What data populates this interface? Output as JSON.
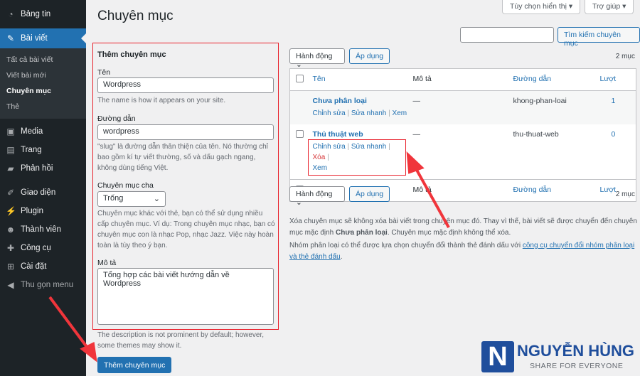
{
  "sidebar": {
    "items": [
      {
        "label": "Bảng tin",
        "icon": "dashboard-icon"
      },
      {
        "label": "Bài viết",
        "icon": "pin-icon",
        "active": true
      },
      {
        "label": "Media",
        "icon": "media-icon"
      },
      {
        "label": "Trang",
        "icon": "page-icon"
      },
      {
        "label": "Phản hồi",
        "icon": "comment-icon"
      },
      {
        "label": "Giao diện",
        "icon": "brush-icon"
      },
      {
        "label": "Plugin",
        "icon": "plugin-icon"
      },
      {
        "label": "Thành viên",
        "icon": "user-icon"
      },
      {
        "label": "Công cụ",
        "icon": "wrench-icon"
      },
      {
        "label": "Cài đặt",
        "icon": "settings-icon"
      },
      {
        "label": "Thu gọn menu",
        "icon": "collapse-icon"
      }
    ],
    "submenu": [
      "Tất cả bài viết",
      "Viết bài mới",
      "Chuyên mục",
      "Thẻ"
    ]
  },
  "header": {
    "title": "Chuyên mục",
    "screen_options": "Tùy chọn hiển thị ▾",
    "help": "Trợ giúp ▾"
  },
  "search": {
    "value": "",
    "button": "Tìm kiếm chuyên mục"
  },
  "form": {
    "heading": "Thêm chuyên mục",
    "name_label": "Tên",
    "name_value": "Wordpress",
    "name_help": "The name is how it appears on your site.",
    "slug_label": "Đường dẫn",
    "slug_value": "wordpress",
    "slug_help": "\"slug\" là đường dẫn thân thiện của tên. Nó thường chỉ bao gồm kí tự viết thường, số và dấu gạch ngang, không dùng tiếng Việt.",
    "parent_label": "Chuyên mục cha",
    "parent_value": "Trống",
    "parent_help": "Chuyên mục khác với thẻ, bạn có thể sử dụng nhiều cấp chuyên mục. Ví dụ: Trong chuyên mục nhạc, bạn có chuyên mục con là nhạc Pop, nhạc Jazz. Việc này hoàn toàn là tùy theo ý bạn.",
    "desc_label": "Mô tả",
    "desc_value": "Tổng hợp các bài viết hướng dẫn về Wordpress",
    "desc_help": "The description is not prominent by default; however, some themes may show it.",
    "submit": "Thêm chuyên mục"
  },
  "bulk": {
    "action": "Hành động",
    "apply": "Áp dụng",
    "count": "2 mục"
  },
  "table": {
    "columns": [
      "Tên",
      "Mô tả",
      "Đường dẫn",
      "Lượt"
    ],
    "rows": [
      {
        "name": "Chưa phân loại",
        "desc": "—",
        "slug": "khong-phan-loai",
        "count": "1",
        "actions": [
          "Chỉnh sửa",
          "Sửa nhanh",
          "Xem"
        ]
      },
      {
        "name": "Thủ thuật web",
        "desc": "—",
        "slug": "thu-thuat-web",
        "count": "0",
        "actions": [
          "Chỉnh sửa",
          "Sửa nhanh",
          "Xóa",
          "Xem"
        ]
      }
    ]
  },
  "notes": {
    "p1a": "Xóa chuyên mục sẽ không xóa bài viết trong chuyên mục đó. Thay vì thế, bài viết sẽ được chuyển đến chuyên mục mặc định ",
    "p1b": "Chưa phân loại",
    "p1c": ". Chuyên mục mặc định không thể xóa.",
    "p2a": "Nhóm phân loại có thể được lựa chọn chuyển đổi thành thẻ đánh dấu với ",
    "p2link": "công cụ chuyển đổi nhóm phân loại và thẻ đánh dấu",
    "p2b": "."
  },
  "logo": {
    "name": "NGUYỄN HÙNG",
    "tagline": "SHARE FOR EVERYONE",
    "color": "#1f4e9c"
  },
  "colors": {
    "accent": "#2271b1",
    "highlight": "#e8202a"
  }
}
